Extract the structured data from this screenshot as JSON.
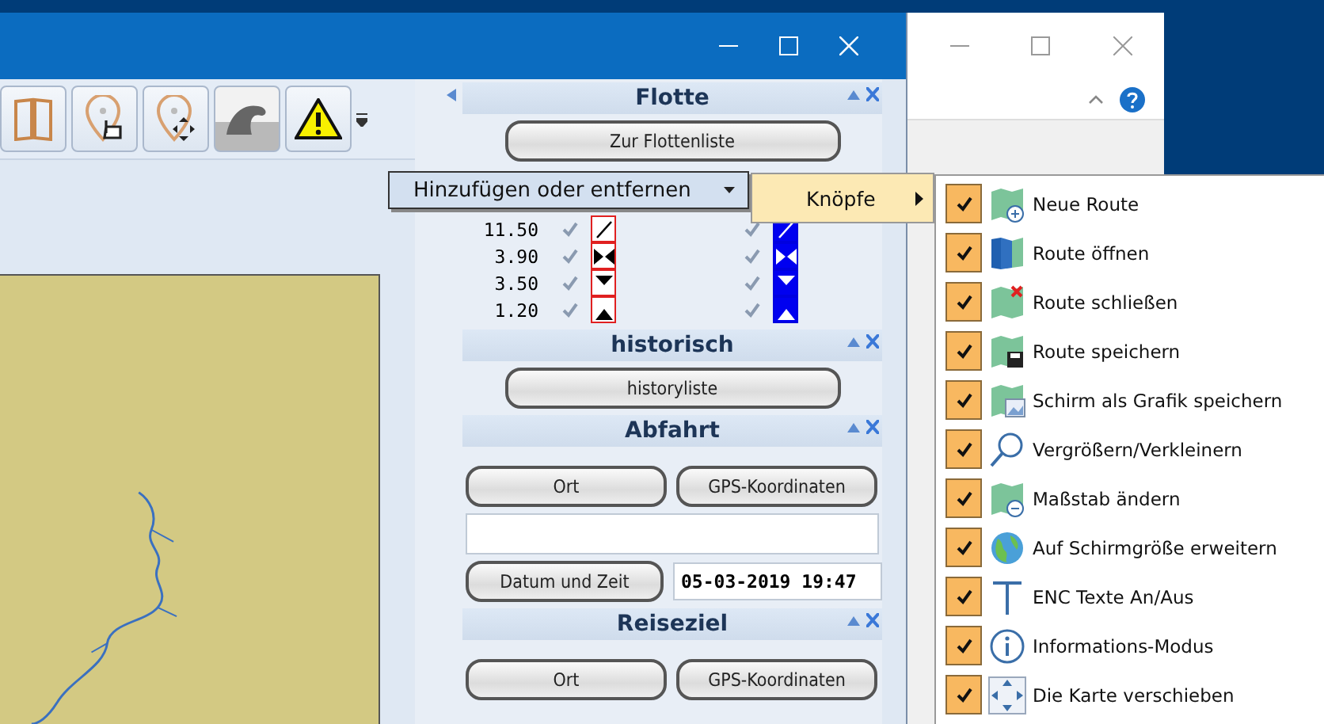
{
  "sidebar": {
    "sections": [
      {
        "kind": "fleet",
        "title": "Flotte",
        "button": "Zur Flottenliste",
        "rows": [
          {
            "value": "11.50",
            "checked_a": true,
            "checked_b": true,
            "kind": "line"
          },
          {
            "value": "3.90",
            "checked_a": true,
            "checked_b": true,
            "kind": "bowtie"
          },
          {
            "value": "3.50",
            "checked_a": true,
            "checked_b": true,
            "kind": "down"
          },
          {
            "value": "1.20",
            "checked_a": true,
            "checked_b": true,
            "kind": "up"
          }
        ]
      },
      {
        "kind": "list",
        "title": "historisch",
        "button": "historyliste"
      },
      {
        "kind": "place",
        "title": "Abfahrt",
        "buttons": [
          "Ort",
          "GPS-Koordinaten"
        ],
        "date_button": "Datum und Zeit",
        "date_value": "05-03-2019 19:47"
      },
      {
        "kind": "place",
        "title": "Reiseziel",
        "buttons": [
          "Ort",
          "GPS-Koordinaten"
        ]
      }
    ]
  },
  "context_menu": {
    "label": "Hinzufügen oder entfernen",
    "submenu": "Knöpfe",
    "items": [
      {
        "label": "Neue Route",
        "checked": true
      },
      {
        "label": "Route öffnen",
        "checked": true
      },
      {
        "label": "Route schließen",
        "checked": true
      },
      {
        "label": "Route speichern",
        "checked": true
      },
      {
        "label": "Schirm als Grafik speichern",
        "checked": true
      },
      {
        "label": "Vergrößern/Verkleinern",
        "checked": true
      },
      {
        "label": "Maßstab ändern",
        "checked": true
      },
      {
        "label": "Auf Schirmgröße erweitern",
        "checked": true
      },
      {
        "label": "ENC Texte An/Aus",
        "checked": true
      },
      {
        "label": "Informations-Modus",
        "checked": true
      },
      {
        "label": "Die Karte verschieben",
        "checked": true
      }
    ]
  }
}
